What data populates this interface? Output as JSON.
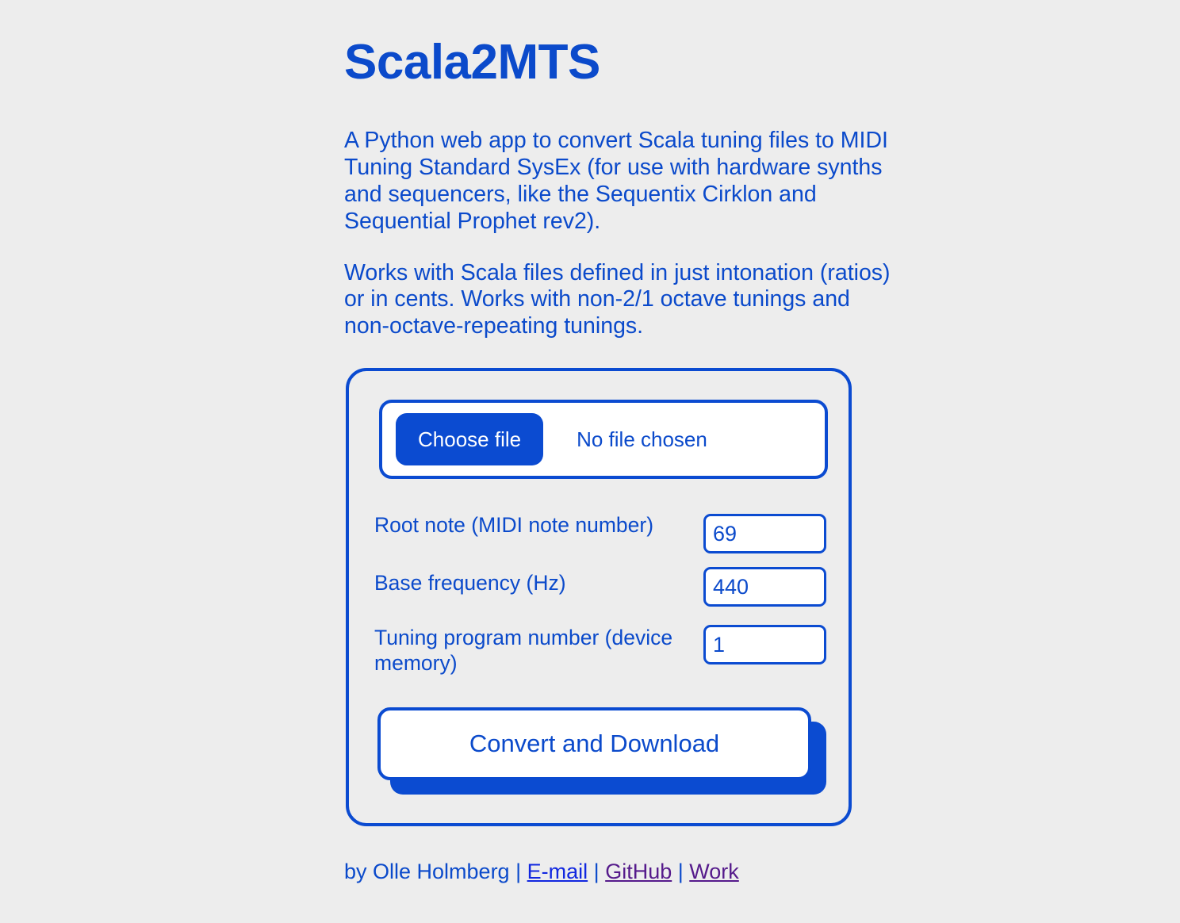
{
  "theme": {
    "page_background": "#ededed",
    "brand_blue": "#0b4bd1",
    "text_blue": "#0b4acb",
    "link_unvisited": "#1127e0",
    "link_visited": "#551a8b",
    "white": "#ffffff"
  },
  "header": {
    "title": "Scala2MTS"
  },
  "intro": {
    "paragraph_1": "A Python web app to convert Scala tuning files to MIDI Tuning Standard SysEx (for use with hardware synths and sequencers, like the Sequentix Cirklon and Sequential Prophet rev2).",
    "paragraph_2": "Works with Scala files defined in just intonation (ratios) or in cents. Works with non-2/1 octave tunings and non-octave-repeating tunings."
  },
  "form": {
    "file_input": {
      "button_label": "Choose file",
      "status_text": "No file chosen"
    },
    "fields": [
      {
        "label": "Root note (MIDI note number)",
        "value": "69",
        "name": "root-note"
      },
      {
        "label": "Base frequency (Hz)",
        "value": "440",
        "name": "base-frequency"
      },
      {
        "label": "Tuning program number (device memory)",
        "value": "1",
        "name": "tuning-program-number"
      }
    ],
    "submit_label": "Convert and Download"
  },
  "footer": {
    "byline": "by Olle Holmberg",
    "sep": "|",
    "links": [
      {
        "label": "E-mail",
        "state": "unvisited"
      },
      {
        "label": "GitHub",
        "state": "visited"
      },
      {
        "label": "Work",
        "state": "visited"
      }
    ]
  }
}
